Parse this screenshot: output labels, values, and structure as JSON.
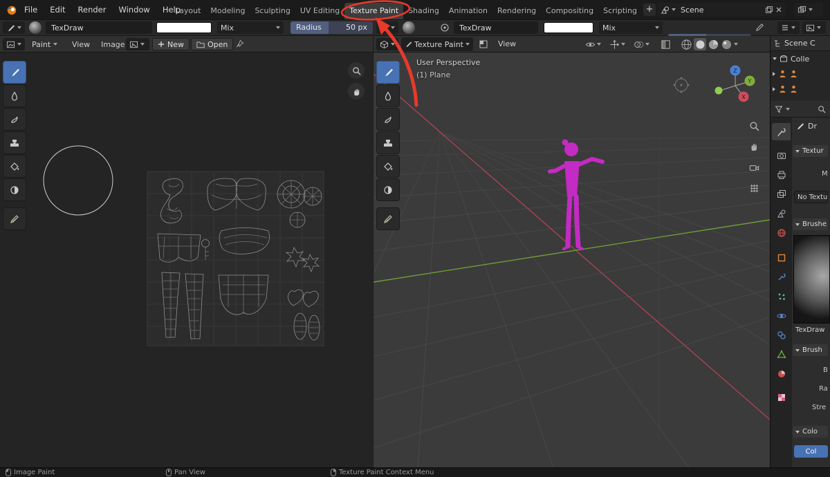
{
  "topbar": {
    "menus": [
      "File",
      "Edit",
      "Render",
      "Window",
      "Help"
    ],
    "tabs": [
      {
        "label": "Layout"
      },
      {
        "label": "Modeling"
      },
      {
        "label": "Sculpting"
      },
      {
        "label": "UV Editing"
      },
      {
        "label": "Texture Paint",
        "active": true
      },
      {
        "label": "Shading"
      },
      {
        "label": "Animation"
      },
      {
        "label": "Rendering"
      },
      {
        "label": "Compositing"
      },
      {
        "label": "Scripting"
      }
    ],
    "add_tab_label": "+",
    "scene_label": "Scene"
  },
  "tool_settings": {
    "brush_name": "TexDraw",
    "blend_mode": "Mix",
    "radius_label": "Radius",
    "radius_value": "50 px"
  },
  "image_editor": {
    "mode_label": "Paint",
    "menus": [
      "View",
      "Image"
    ],
    "new_button_label": "New",
    "open_button_label": "Open",
    "tool_icons": [
      "draw-brush-icon",
      "soften-icon",
      "smear-icon",
      "clone-icon",
      "fill-icon",
      "mask-icon",
      "annotate-icon"
    ]
  },
  "viewport": {
    "mode_label": "Texture Paint",
    "view_menu_label": "View",
    "overlay_line1": "User Perspective",
    "overlay_line2": "(1) Plane",
    "axis_x": "X",
    "axis_y": "Y",
    "axis_z": "Z",
    "tool_icons": [
      "draw-brush-icon",
      "soften-icon",
      "smear-icon",
      "clone-icon",
      "fill-icon",
      "mask-icon",
      "annotate-icon"
    ]
  },
  "outliner": {
    "title": "Scene C",
    "collection_label": "Colle"
  },
  "properties": {
    "tool_label": "Dr",
    "texture_panel_label": "Textur",
    "mode_label_cut": "M",
    "no_texture_label": "No Textu",
    "brushes_panel_label": "Brushe",
    "brush_name": "TexDraw",
    "brush_panel_label": "Brush",
    "blend_label_cut": "B",
    "radius_label_cut": "Ra",
    "strength_label_cut": "Stre",
    "color_panel_label": "Colo",
    "color_button_label": "Col"
  },
  "status_bar": {
    "items": [
      {
        "label": "Image Paint",
        "icon": "mouse-left-icon"
      },
      {
        "label": "Pan View",
        "icon": "mouse-middle-icon"
      },
      {
        "label": "Texture Paint Context Menu",
        "icon": "mouse-right-icon"
      }
    ]
  },
  "colors": {
    "accent": "#4772b3",
    "annotation_red": "#e8392b",
    "model_magenta": "#c42ac4",
    "axis_x_red": "#a94350",
    "axis_y_green": "#6f9d36"
  }
}
